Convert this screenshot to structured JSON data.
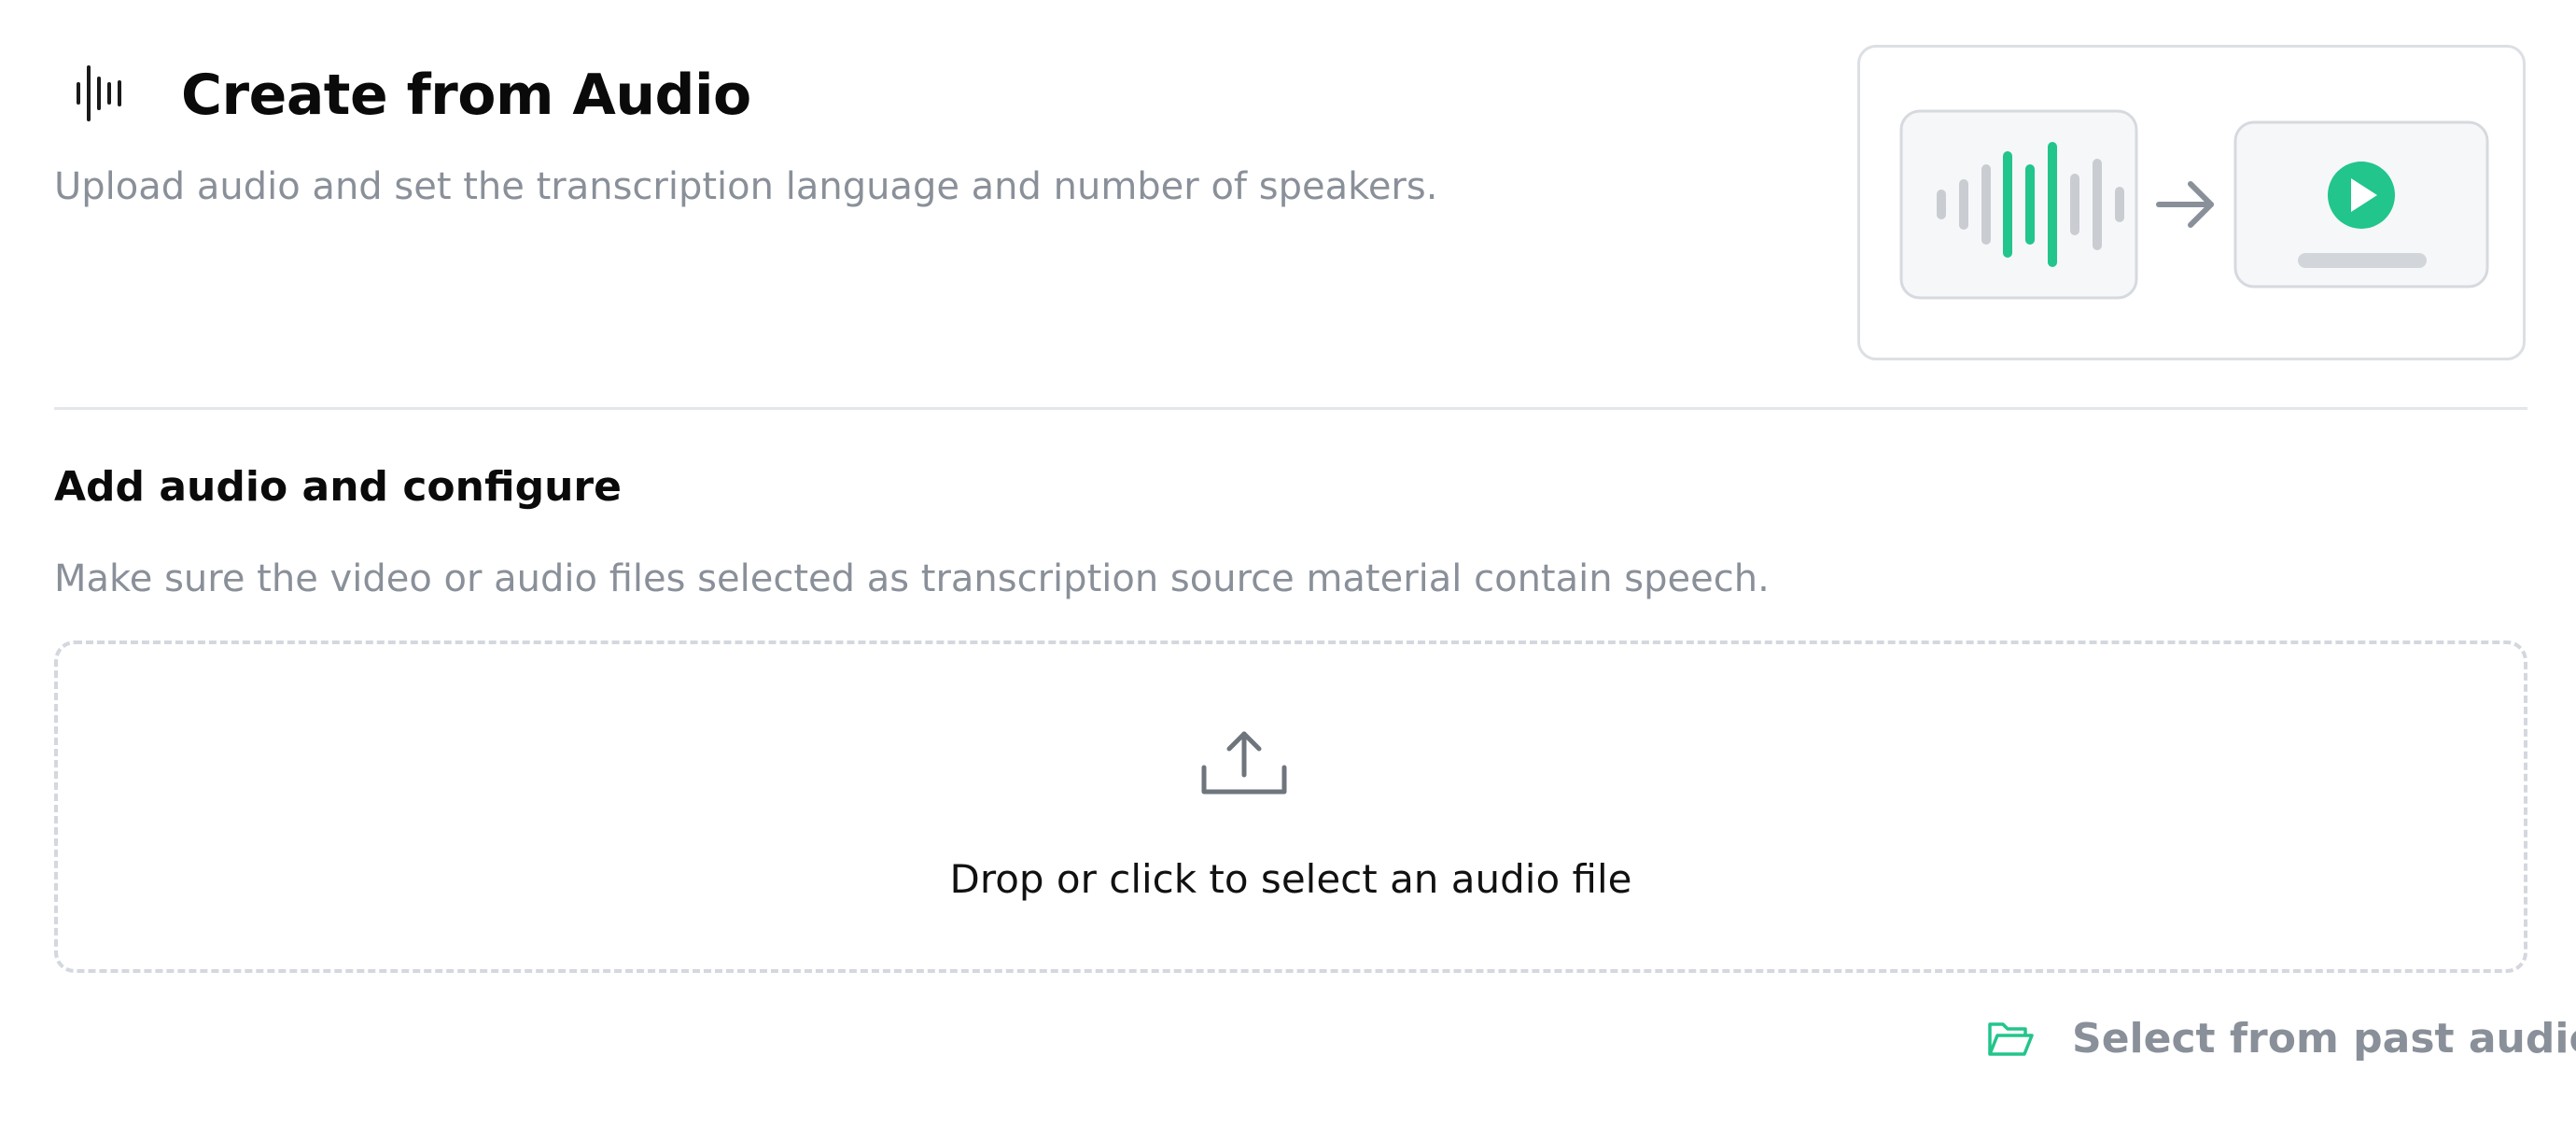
{
  "header": {
    "icon": "waveform-icon",
    "title": "Create from Audio",
    "subtitle": "Upload audio and set the transcription language and number of speakers."
  },
  "illustration": {
    "icons": [
      "audio-waveform-icon",
      "arrow-right-icon",
      "play-icon"
    ],
    "accent_color": "#22c58b",
    "muted_color": "#c9ccd1"
  },
  "section": {
    "title": "Add audio and configure",
    "description": "Make sure the video or audio files selected as transcription source material contain speech."
  },
  "dropzone": {
    "icon": "upload-icon",
    "label": "Drop or click to select an audio file"
  },
  "past_audio": {
    "icon": "folder-open-icon",
    "label": "Select from past audio",
    "icon_color": "#22c58b"
  },
  "colors": {
    "accent": "#22c58b",
    "muted_text": "#8a9099",
    "border": "#dcdfe3"
  }
}
